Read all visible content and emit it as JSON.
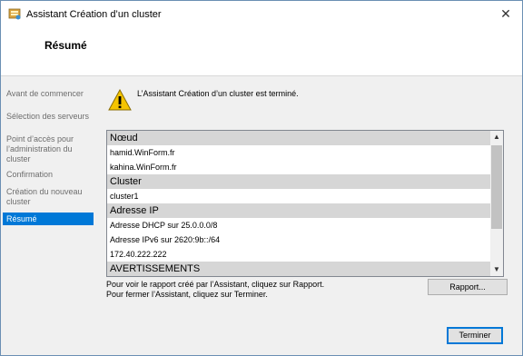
{
  "window": {
    "title": "Assistant Création d’un cluster"
  },
  "header": {
    "title": "Résumé"
  },
  "sidebar": {
    "items": [
      {
        "label": "Avant de commencer",
        "active": false
      },
      {
        "label": "Sélection des serveurs",
        "active": false
      },
      {
        "label": "Point d’accès pour l’administration du cluster",
        "active": false
      },
      {
        "label": "Confirmation",
        "active": false
      },
      {
        "label": "Création du nouveau cluster",
        "active": false
      },
      {
        "label": "Résumé",
        "active": true
      }
    ]
  },
  "main": {
    "status_message": "L’Assistant Création d’un cluster est terminé.",
    "list": [
      {
        "text": "Nœud",
        "header": true
      },
      {
        "text": "hamid.WinForm.fr",
        "header": false
      },
      {
        "text": "kahina.WinForm.fr",
        "header": false
      },
      {
        "text": "Cluster",
        "header": true
      },
      {
        "text": "cluster1",
        "header": false
      },
      {
        "text": "Adresse IP",
        "header": true
      },
      {
        "text": "Adresse DHCP sur 25.0.0.0/8",
        "header": false
      },
      {
        "text": "Adresse IPv6 sur 2620:9b::/64",
        "header": false
      },
      {
        "text": "172.40.222.222",
        "header": false
      },
      {
        "text": "AVERTISSEMENTS",
        "header": true
      }
    ],
    "info_report": "Pour voir le rapport créé par l’Assistant, cliquez sur Rapport.",
    "info_finish": "Pour fermer l’Assistant, cliquez sur Terminer."
  },
  "buttons": {
    "report": "Rapport...",
    "finish": "Terminer"
  },
  "icons": {
    "app": "cluster-wizard-icon",
    "warning": "warning-icon",
    "close": "close-icon"
  },
  "colors": {
    "accent": "#0078d7",
    "warning": "#f5c400"
  }
}
